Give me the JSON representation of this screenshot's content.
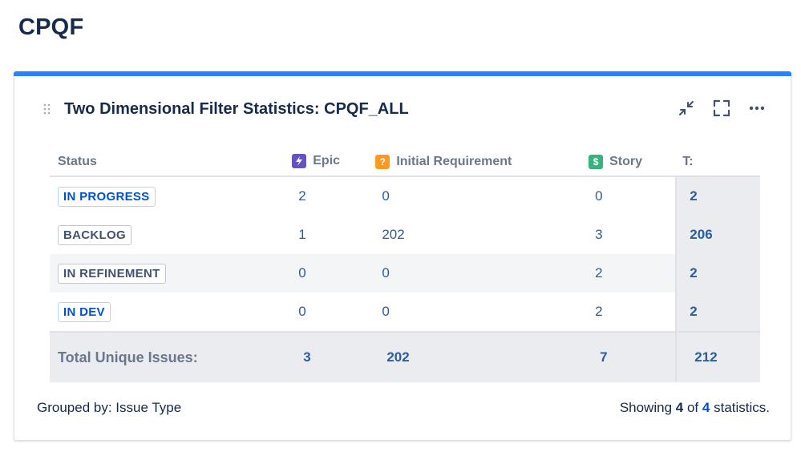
{
  "page": {
    "title": "CPQF"
  },
  "gadget": {
    "title": "Two Dimensional Filter Statistics: CPQF_ALL",
    "accent_color": "#2684ff",
    "actions": [
      "minimize-icon",
      "fullscreen-icon",
      "more-icon"
    ]
  },
  "table": {
    "headers": {
      "status": "Status",
      "epic": "Epic",
      "initial_requirement": "Initial Requirement",
      "story": "Story",
      "total": "T:"
    },
    "type_icons": {
      "epic": {
        "glyph": "⚡",
        "color": "#6554c0"
      },
      "initial_requirement": {
        "glyph": "?",
        "color": "#ff991f"
      },
      "story": {
        "glyph": "$",
        "color": "#36b37e"
      }
    },
    "rows": [
      {
        "status": "IN PROGRESS",
        "style": "blue",
        "epic": "2",
        "initial_requirement": "0",
        "story": "0",
        "total": "2"
      },
      {
        "status": "BACKLOG",
        "style": "grey",
        "epic": "1",
        "initial_requirement": "202",
        "story": "3",
        "total": "206"
      },
      {
        "status": "IN REFINEMENT",
        "style": "grey",
        "epic": "0",
        "initial_requirement": "0",
        "story": "2",
        "total": "2"
      },
      {
        "status": "IN DEV",
        "style": "blue",
        "epic": "0",
        "initial_requirement": "0",
        "story": "2",
        "total": "2"
      }
    ],
    "totals": {
      "label": "Total Unique Issues:",
      "epic": "3",
      "initial_requirement": "202",
      "story": "7",
      "total": "212"
    }
  },
  "footer": {
    "grouped_by": "Grouped by: Issue Type",
    "showing_prefix": "Showing",
    "showing_count": "4",
    "showing_of": "of",
    "showing_total": "4",
    "showing_suffix": "statistics."
  }
}
